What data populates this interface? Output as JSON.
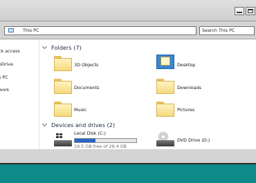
{
  "window": {
    "address": "This PC",
    "search_placeholder": "Search This PC"
  },
  "nav": {
    "items": [
      "ck access",
      "eDrive",
      "s PC",
      "work"
    ]
  },
  "folders": {
    "header": "Folders (7)",
    "items": [
      "3D Objects",
      "Desktop",
      "Documents",
      "Downloads",
      "Music",
      "Pictures"
    ]
  },
  "drives": {
    "header": "Devices and drives (2)",
    "local": {
      "name": "Local Disk (C:)",
      "free_text": "19.5 GB free of 29.4 GB",
      "used_fraction": 0.34
    },
    "dvd": {
      "name": "DVD Drive (D:)"
    }
  },
  "colors": {
    "desktop": "#0f8a8a",
    "usage_bar": "#2a66c8"
  }
}
